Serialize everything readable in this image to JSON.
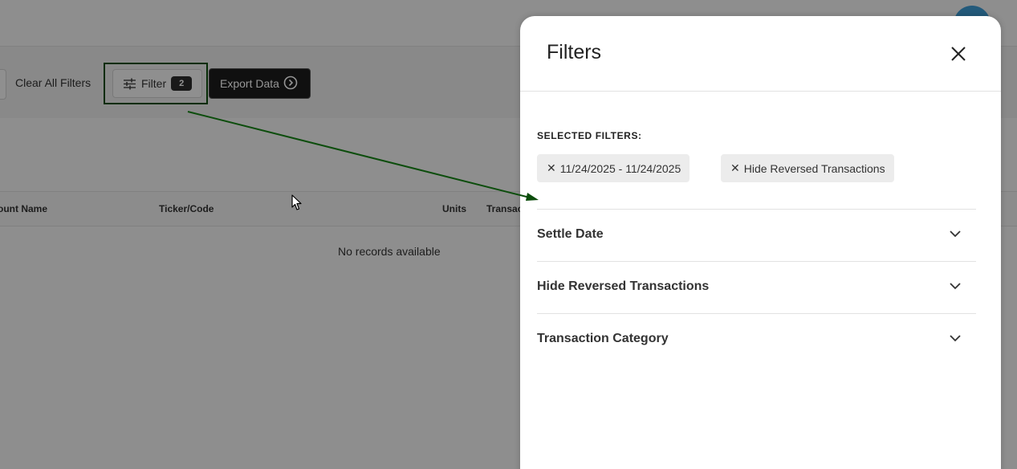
{
  "toolbar": {
    "clear_filters_label": "Clear All Filters",
    "filter_label": "Filter",
    "filter_count": "2",
    "export_label": "Export Data"
  },
  "table": {
    "columns": [
      "ount Name",
      "Ticker/Code",
      "Units",
      "Transac"
    ],
    "empty_message": "No records available"
  },
  "drawer": {
    "title": "Filters",
    "selected_filters_label": "SELECTED FILTERS:",
    "chips": [
      {
        "label": "11/24/2025 - 11/24/2025"
      },
      {
        "label": "Hide Reversed Transactions"
      }
    ],
    "sections": [
      {
        "label": "Settle Date"
      },
      {
        "label": "Hide Reversed Transactions"
      },
      {
        "label": "Transaction Category"
      }
    ]
  },
  "colors": {
    "highlight": "#0c4d0c",
    "avatar": "#3d9bd5",
    "export_bg": "#1c1c1c"
  },
  "icons": {
    "filter": "sliders-icon",
    "export": "arrow-circle-right-icon",
    "close": "close-icon",
    "chip_remove": "x-icon",
    "section": "chevron-down-icon"
  }
}
